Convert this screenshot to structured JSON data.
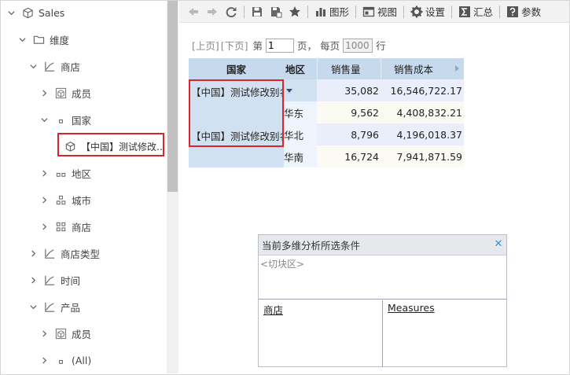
{
  "tree": {
    "items": [
      {
        "label": "Sales",
        "icon": "cube-icon",
        "expanded": true
      },
      {
        "label": "维度",
        "icon": "folder-icon",
        "expanded": true
      },
      {
        "label": "商店",
        "icon": "hierarchy-icon",
        "expanded": true
      },
      {
        "label": "成员",
        "icon": "member-icon",
        "expanded": false
      },
      {
        "label": "国家",
        "icon": "level1-icon",
        "expanded": true
      },
      {
        "label": "【中国】测试修改...",
        "icon": "cube-member-icon",
        "selected": true
      },
      {
        "label": "地区",
        "icon": "level2-icon",
        "expanded": false
      },
      {
        "label": "城市",
        "icon": "level3-icon",
        "expanded": false
      },
      {
        "label": "商店",
        "icon": "level4-icon",
        "expanded": false
      },
      {
        "label": "商店类型",
        "icon": "hierarchy-icon",
        "expanded": false
      },
      {
        "label": "时间",
        "icon": "hierarchy-icon",
        "expanded": false
      },
      {
        "label": "产品",
        "icon": "hierarchy-icon",
        "expanded": true
      },
      {
        "label": "成员",
        "icon": "member-icon",
        "expanded": false
      },
      {
        "label": "(All)",
        "icon": "level1-icon",
        "expanded": false
      }
    ]
  },
  "toolbar": {
    "chart_label": "图形",
    "view_label": "视图",
    "settings_label": "设置",
    "summary_label": "汇总",
    "params_label": "参数"
  },
  "paging": {
    "prev": "[上页]",
    "next": "[下页]",
    "page_prefix": "第",
    "page_value": "1",
    "page_suffix": "页，",
    "per_page_prefix": "每页",
    "per_page_value": "1000",
    "per_page_suffix": "行"
  },
  "pivot": {
    "headers": [
      "国家",
      "地区",
      "销售量",
      "销售成本"
    ],
    "country_label": "【中国】测试修改别名",
    "rows": [
      {
        "region": "",
        "qty": "35,082",
        "cost": "16,546,722.17"
      },
      {
        "region": "华东",
        "qty": "9,562",
        "cost": "4,408,832.21"
      },
      {
        "region": "华北",
        "qty": "8,796",
        "cost": "4,196,018.37"
      },
      {
        "region": "华南",
        "qty": "16,724",
        "cost": "7,941,871.59"
      }
    ]
  },
  "filter_panel": {
    "title": "当前多维分析所选条件",
    "slicer_label": "<切块区>",
    "row_axis": "商店",
    "col_axis": "Measures"
  },
  "colors": {
    "header_bg": "#c7d9ed",
    "highlight_border": "#d9262c",
    "close_icon": "#3a8fd6"
  }
}
